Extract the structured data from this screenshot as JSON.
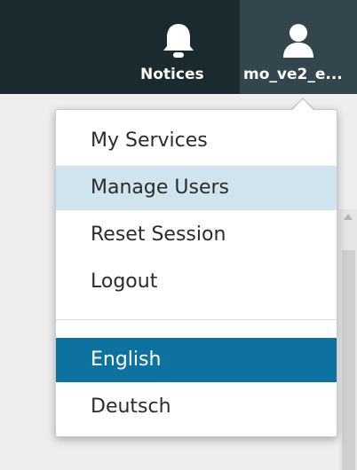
{
  "header": {
    "notices": {
      "icon": "bell-icon",
      "label": "Notices"
    },
    "user": {
      "icon": "user-icon",
      "label": "mo_ve2_e..."
    }
  },
  "dropdown": {
    "account_items": [
      {
        "label": "My Services"
      },
      {
        "label": "Manage Users",
        "state": "hover"
      },
      {
        "label": "Reset Session"
      },
      {
        "label": "Logout"
      }
    ],
    "language_items": [
      {
        "label": "English",
        "state": "selected"
      },
      {
        "label": "Deutsch"
      }
    ]
  },
  "colors": {
    "topbar": "#1b2a2f",
    "user_tab_active": "#33454d",
    "hover_row": "#cfe4ee",
    "selected_row": "#0e72a0"
  }
}
